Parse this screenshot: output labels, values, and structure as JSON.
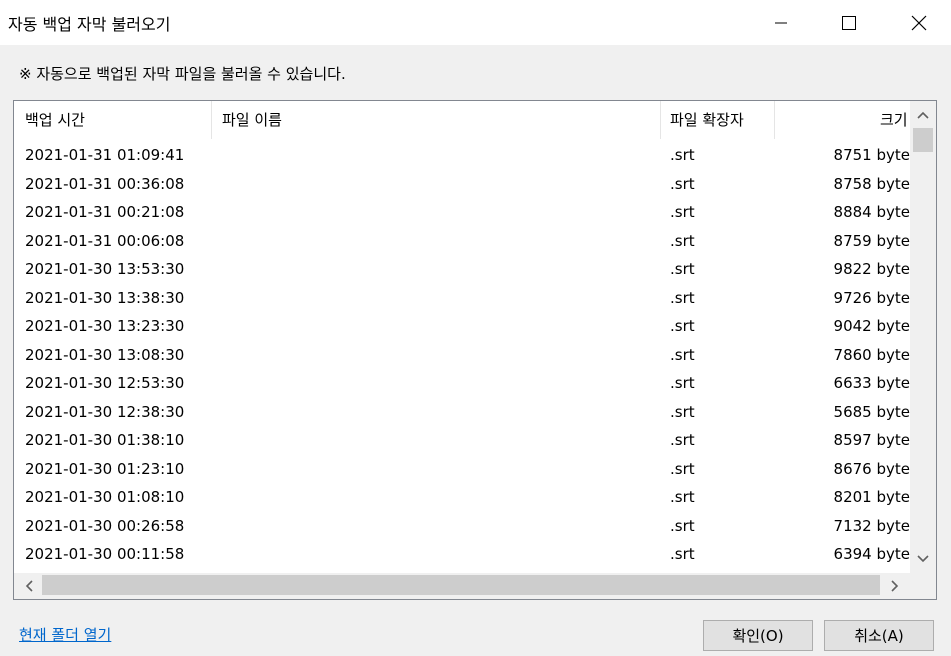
{
  "window": {
    "title": "자동 백업 자막 불러오기"
  },
  "notice": "※ 자동으로 백업된 자막 파일을 불러올 수 있습니다.",
  "columns": {
    "time": "백업 시간",
    "name": "파일 이름",
    "ext": "파일 확장자",
    "size": "크기"
  },
  "rows": [
    {
      "time": "2021-01-31 01:09:41",
      "name": "",
      "ext": ".srt",
      "size": "8751 byte"
    },
    {
      "time": "2021-01-31 00:36:08",
      "name": "",
      "ext": ".srt",
      "size": "8758 byte"
    },
    {
      "time": "2021-01-31 00:21:08",
      "name": "",
      "ext": ".srt",
      "size": "8884 byte"
    },
    {
      "time": "2021-01-31 00:06:08",
      "name": "",
      "ext": ".srt",
      "size": "8759 byte"
    },
    {
      "time": "2021-01-30 13:53:30",
      "name": "",
      "ext": ".srt",
      "size": "9822 byte"
    },
    {
      "time": "2021-01-30 13:38:30",
      "name": "",
      "ext": ".srt",
      "size": "9726 byte"
    },
    {
      "time": "2021-01-30 13:23:30",
      "name": "",
      "ext": ".srt",
      "size": "9042 byte"
    },
    {
      "time": "2021-01-30 13:08:30",
      "name": "",
      "ext": ".srt",
      "size": "7860 byte"
    },
    {
      "time": "2021-01-30 12:53:30",
      "name": "",
      "ext": ".srt",
      "size": "6633 byte"
    },
    {
      "time": "2021-01-30 12:38:30",
      "name": "",
      "ext": ".srt",
      "size": "5685 byte"
    },
    {
      "time": "2021-01-30 01:38:10",
      "name": "",
      "ext": ".srt",
      "size": "8597 byte"
    },
    {
      "time": "2021-01-30 01:23:10",
      "name": "",
      "ext": ".srt",
      "size": "8676 byte"
    },
    {
      "time": "2021-01-30 01:08:10",
      "name": "",
      "ext": ".srt",
      "size": "8201 byte"
    },
    {
      "time": "2021-01-30 00:26:58",
      "name": "",
      "ext": ".srt",
      "size": "7132 byte"
    },
    {
      "time": "2021-01-30 00:11:58",
      "name": "",
      "ext": ".srt",
      "size": "6394 byte"
    }
  ],
  "footer": {
    "open_folder_link": "현재 폴더 열기",
    "ok_label": "확인(O)",
    "cancel_label": "취소(A)"
  },
  "icons": {
    "minimize": "minimize-icon",
    "maximize": "maximize-icon",
    "close": "close-icon",
    "scroll_up": "chevron-up-icon",
    "scroll_down": "chevron-down-icon",
    "scroll_left": "chevron-left-icon",
    "scroll_right": "chevron-right-icon"
  },
  "colors": {
    "link": "#0066cc",
    "titlebar": "#ffffff",
    "background": "#f0f0f0"
  }
}
